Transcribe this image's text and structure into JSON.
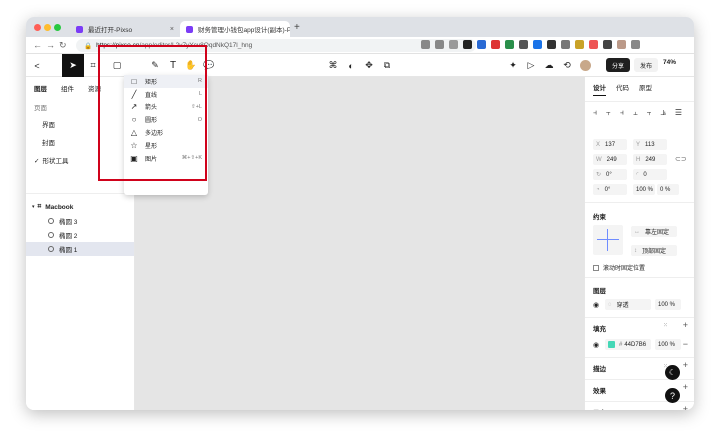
{
  "browser": {
    "tabs": [
      {
        "title": "最近打开-Pixso",
        "close": "×"
      },
      {
        "title": "财务管理小钱包app设计(副本)-P",
        "close": "×"
      }
    ],
    "new_tab": "+",
    "url_host": "https://pixso.cn",
    "url_path": "/app/editor/L2v7yYcv8OqdNkQ17l_hng"
  },
  "toolbar": {
    "back": "<",
    "share": "分享",
    "publish": "发布",
    "zoom": "74%"
  },
  "left_panel": {
    "tabs": [
      "图层",
      "组件",
      "资源"
    ],
    "pages_title": "页面",
    "pages": [
      "界面",
      "封面",
      "形状工具"
    ],
    "selected_page": "形状工具",
    "frame": "Macbook",
    "layers": [
      "椭圆 3",
      "椭圆 2",
      "椭圆 1"
    ]
  },
  "shape_menu": {
    "items": [
      {
        "label": "矩形",
        "shortcut": "R",
        "icon": "□"
      },
      {
        "label": "直线",
        "shortcut": "L",
        "icon": "╱"
      },
      {
        "label": "箭头",
        "shortcut": "⇧+L",
        "icon": "↗"
      },
      {
        "label": "圆形",
        "shortcut": "O",
        "icon": "○"
      },
      {
        "label": "多边形",
        "shortcut": "",
        "icon": "△"
      },
      {
        "label": "星形",
        "shortcut": "",
        "icon": "☆"
      },
      {
        "label": "图片",
        "shortcut": "⌘+⇧+K",
        "icon": "▣"
      }
    ]
  },
  "right_panel": {
    "tabs": [
      "设计",
      "代码",
      "原型"
    ],
    "x": "137",
    "y": "113",
    "w": "249",
    "h": "249",
    "rotation": "0°",
    "radius": "0",
    "angle": "0°",
    "p1": "100 %",
    "p2": "0 %",
    "x_label": "X",
    "y_label": "Y",
    "w_label": "W",
    "h_label": "H",
    "constraints_title": "约束",
    "constraint_h": "靠左固定",
    "constraint_v": "顶部固定",
    "scroll_fixed": "滚动时固定位置",
    "layer_title": "图层",
    "blend": "穿透",
    "opacity": "100 %",
    "fill_title": "填充",
    "fill_hex": "44D7B6",
    "fill_opacity": "100 %",
    "fill_color": "#44D7B6",
    "stroke_title": "描边",
    "effects_title": "效果",
    "export_title": "导出"
  }
}
